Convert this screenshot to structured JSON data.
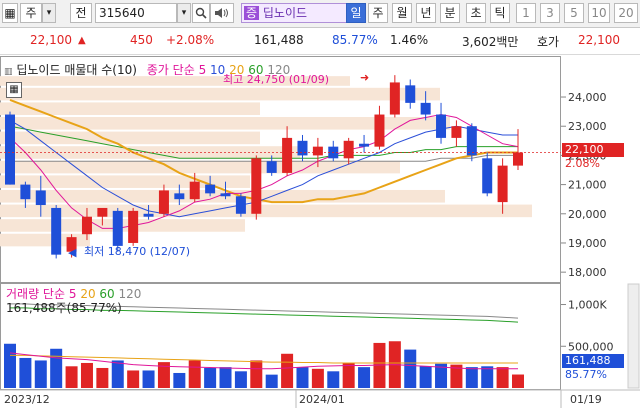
{
  "toolbar": {
    "market_label": "주",
    "market_dropdown": "▾",
    "filter_label": "전",
    "code": "315640",
    "buttons": [
      "일",
      "주",
      "월",
      "년",
      "분",
      "초",
      "틱"
    ],
    "intervals": [
      "1",
      "3",
      "5",
      "10",
      "20"
    ],
    "name_prefix": "증",
    "name": "딥노이드",
    "search_icon": "magnifier",
    "sound_icon": "speaker"
  },
  "quote": {
    "price": "22,100",
    "change": "450",
    "change_pct": "+2.08%",
    "volume": "161,488",
    "vol_ratio": "85.77%",
    "turnover": "1.46%",
    "amount": "3,602백만",
    "bid_label": "호가",
    "bid_price": "22,100"
  },
  "price_panel": {
    "legend_title": "딥노이드 매물대 수(10)",
    "legend_ma_label": "종가 단순",
    "ma_periods": [
      "5",
      "10",
      "20",
      "60",
      "120"
    ],
    "high_label": "최고 24,750 (01/09)",
    "low_label": "최저 18,470 (12/07)",
    "current_price": "22,100",
    "current_pct": "2.08%",
    "y_ticks": [
      "24,000",
      "23,000",
      "22,000",
      "21,000",
      "20,000",
      "19,000",
      "18,000"
    ]
  },
  "volume_panel": {
    "legend_title": "거래량 단순",
    "ma_periods": [
      "5",
      "20",
      "60",
      "120"
    ],
    "vol_label": "161,488주(85.77%)",
    "current_vol": "161,488",
    "current_pct": "85.77%",
    "y_ticks": [
      "1,000K",
      "500,000"
    ]
  },
  "x_labels": [
    "2023/12",
    "2024/01",
    "01/19"
  ],
  "colors": {
    "up": "#e02424",
    "down": "#1f4fd8",
    "ma5": "#e0169a",
    "ma10": "#2b4fd8",
    "ma20": "#e8a317",
    "ma60": "#2aa02a",
    "ma120": "#888888"
  },
  "chart_data": {
    "type": "candlestick",
    "y_range": [
      17800,
      25200
    ],
    "candles": [
      {
        "o": 23400,
        "h": 23500,
        "l": 21000,
        "c": 21000
      },
      {
        "o": 21000,
        "h": 21100,
        "l": 20200,
        "c": 20500
      },
      {
        "o": 20800,
        "h": 21300,
        "l": 19900,
        "c": 20300
      },
      {
        "o": 20200,
        "h": 20300,
        "l": 18470,
        "c": 18600
      },
      {
        "o": 18700,
        "h": 19300,
        "l": 18500,
        "c": 19200
      },
      {
        "o": 19300,
        "h": 20200,
        "l": 19100,
        "c": 19900
      },
      {
        "o": 19900,
        "h": 20100,
        "l": 19600,
        "c": 20200
      },
      {
        "o": 20100,
        "h": 20200,
        "l": 18700,
        "c": 18900
      },
      {
        "o": 19000,
        "h": 20200,
        "l": 18900,
        "c": 20100
      },
      {
        "o": 20000,
        "h": 20300,
        "l": 19800,
        "c": 19900
      },
      {
        "o": 20000,
        "h": 21000,
        "l": 19900,
        "c": 20800
      },
      {
        "o": 20700,
        "h": 21000,
        "l": 20300,
        "c": 20500
      },
      {
        "o": 20500,
        "h": 21400,
        "l": 20400,
        "c": 21100
      },
      {
        "o": 21000,
        "h": 21300,
        "l": 20600,
        "c": 20700
      },
      {
        "o": 20700,
        "h": 21100,
        "l": 20500,
        "c": 20600
      },
      {
        "o": 20600,
        "h": 20700,
        "l": 19900,
        "c": 20000
      },
      {
        "o": 20000,
        "h": 22000,
        "l": 19800,
        "c": 21900
      },
      {
        "o": 21800,
        "h": 22000,
        "l": 21300,
        "c": 21400
      },
      {
        "o": 21400,
        "h": 23000,
        "l": 21300,
        "c": 22600
      },
      {
        "o": 22500,
        "h": 22700,
        "l": 21800,
        "c": 22000
      },
      {
        "o": 22000,
        "h": 22600,
        "l": 21600,
        "c": 22300
      },
      {
        "o": 22300,
        "h": 22500,
        "l": 21800,
        "c": 21900
      },
      {
        "o": 21900,
        "h": 22600,
        "l": 21700,
        "c": 22500
      },
      {
        "o": 22400,
        "h": 22700,
        "l": 22100,
        "c": 22300
      },
      {
        "o": 22300,
        "h": 23700,
        "l": 22200,
        "c": 23400
      },
      {
        "o": 23400,
        "h": 24750,
        "l": 23300,
        "c": 24500
      },
      {
        "o": 24400,
        "h": 24600,
        "l": 23600,
        "c": 23800
      },
      {
        "o": 23800,
        "h": 24200,
        "l": 23200,
        "c": 23400
      },
      {
        "o": 23400,
        "h": 23800,
        "l": 22400,
        "c": 22600
      },
      {
        "o": 22600,
        "h": 23200,
        "l": 22300,
        "c": 23000
      },
      {
        "o": 23000,
        "h": 23100,
        "l": 21800,
        "c": 22000
      },
      {
        "o": 21900,
        "h": 22100,
        "l": 20600,
        "c": 20700
      },
      {
        "o": 20400,
        "h": 21900,
        "l": 20000,
        "c": 21650
      },
      {
        "o": 21650,
        "h": 22900,
        "l": 21500,
        "c": 22100
      }
    ],
    "ma5": [
      22600,
      22100,
      21500,
      20800,
      20200,
      19800,
      19500,
      19500,
      19600,
      19700,
      19900,
      20100,
      20400,
      20500,
      20700,
      20700,
      20800,
      21000,
      21300,
      21500,
      21800,
      22000,
      22200,
      22300,
      22500,
      22900,
      23200,
      23300,
      23400,
      23300,
      23000,
      22700,
      22400,
      22300
    ],
    "ma10": [
      23200,
      22900,
      22500,
      22100,
      21700,
      21300,
      20900,
      20600,
      20300,
      20100,
      20000,
      19900,
      20000,
      20100,
      20200,
      20300,
      20400,
      20600,
      20800,
      21000,
      21300,
      21500,
      21700,
      21900,
      22100,
      22400,
      22600,
      22800,
      22900,
      23000,
      22900,
      22800,
      22700,
      22700
    ],
    "ma20": [
      23900,
      23700,
      23500,
      23300,
      23100,
      22900,
      22600,
      22400,
      22100,
      21900,
      21700,
      21400,
      21200,
      21000,
      20800,
      20600,
      20500,
      20400,
      20400,
      20400,
      20500,
      20500,
      20600,
      20700,
      20900,
      21100,
      21300,
      21500,
      21700,
      21900,
      22000,
      22100,
      22100,
      22100
    ],
    "ma60": [
      23000,
      22900,
      22800,
      22700,
      22600,
      22500,
      22400,
      22300,
      22200,
      22100,
      22000,
      21900,
      21900,
      21900,
      21900,
      21900,
      21900,
      21900,
      21900,
      21900,
      21900,
      22000,
      22000,
      22000,
      22000,
      22100,
      22100,
      22200,
      22200,
      22300,
      22300,
      22300,
      22300,
      22300
    ],
    "ma120": [
      21800,
      21800,
      21800,
      21800,
      21800,
      21800,
      21800,
      21800,
      21800,
      21800,
      21800,
      21800,
      21800,
      21800,
      21800,
      21800,
      21800,
      21800,
      21800,
      21800,
      21800,
      21800,
      21800,
      21800,
      21800,
      21800,
      21800,
      21800,
      21900,
      21900,
      21900,
      22000,
      22000,
      22000
    ],
    "volume": [
      530000,
      360000,
      330000,
      470000,
      260000,
      300000,
      240000,
      330000,
      210000,
      210000,
      310000,
      180000,
      330000,
      240000,
      250000,
      200000,
      330000,
      160000,
      410000,
      250000,
      230000,
      200000,
      300000,
      250000,
      540000,
      560000,
      460000,
      260000,
      290000,
      280000,
      250000,
      260000,
      250000,
      161488
    ],
    "vol_ma5": [
      420000,
      400000,
      380000,
      360000,
      350000,
      340000,
      320000,
      300000,
      280000,
      270000,
      260000,
      255000,
      250000,
      245000,
      240000,
      235000,
      230000,
      230000,
      240000,
      250000,
      260000,
      265000,
      270000,
      270000,
      275000,
      280000,
      270000,
      260000,
      250000,
      240000,
      230000,
      230000,
      230000,
      230000
    ],
    "vol_ma20": [
      390000,
      390000,
      385000,
      380000,
      375000,
      370000,
      365000,
      360000,
      355000,
      350000,
      345000,
      340000,
      335000,
      330000,
      325000,
      320000,
      315000,
      310000,
      310000,
      305000,
      305000,
      300000,
      300000,
      300000,
      300000,
      300000,
      300000,
      300000,
      300000,
      300000,
      300000,
      300000,
      300000,
      300000
    ],
    "vol_ma60": [
      960000,
      960000,
      950000,
      950000,
      940000,
      940000,
      930000,
      930000,
      925000,
      920000,
      915000,
      910000,
      905000,
      900000,
      895000,
      890000,
      885000,
      880000,
      875000,
      870000,
      865000,
      860000,
      855000,
      850000,
      845000,
      840000,
      835000,
      830000,
      825000,
      820000,
      815000,
      810000,
      800000,
      790000
    ],
    "volume_y_max": 1150000
  }
}
